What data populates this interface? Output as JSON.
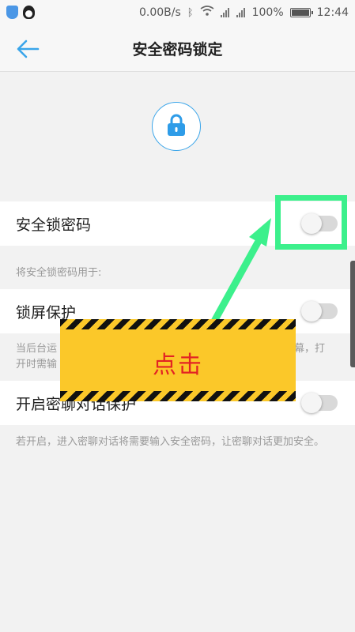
{
  "status_bar": {
    "network_speed": "0.00B/s",
    "battery": "100%",
    "time": "12:44"
  },
  "header": {
    "title": "安全密码锁定"
  },
  "rows": {
    "safe_lock_password": {
      "label": "安全锁密码",
      "enabled": false
    },
    "section_label": "将安全锁密码用于:",
    "lock_screen": {
      "label": "锁屏保护",
      "enabled": false
    },
    "lock_screen_note_1": "当后台运",
    "lock_screen_note_1_end": "幕，打",
    "lock_screen_note_2": "开时需输",
    "secret_chat": {
      "label": "开启密聊对话保护",
      "enabled": false
    },
    "secret_chat_note": "若开启，进入密聊对话将需要输入安全密码，让密聊对话更加安全。"
  },
  "annotation": {
    "banner_text": "点击",
    "highlight_color": "#3cf08c",
    "banner_color": "#fbc829",
    "text_color": "#e32323"
  },
  "colors": {
    "accent": "#3aa5ea",
    "background": "#f2f2f2"
  }
}
